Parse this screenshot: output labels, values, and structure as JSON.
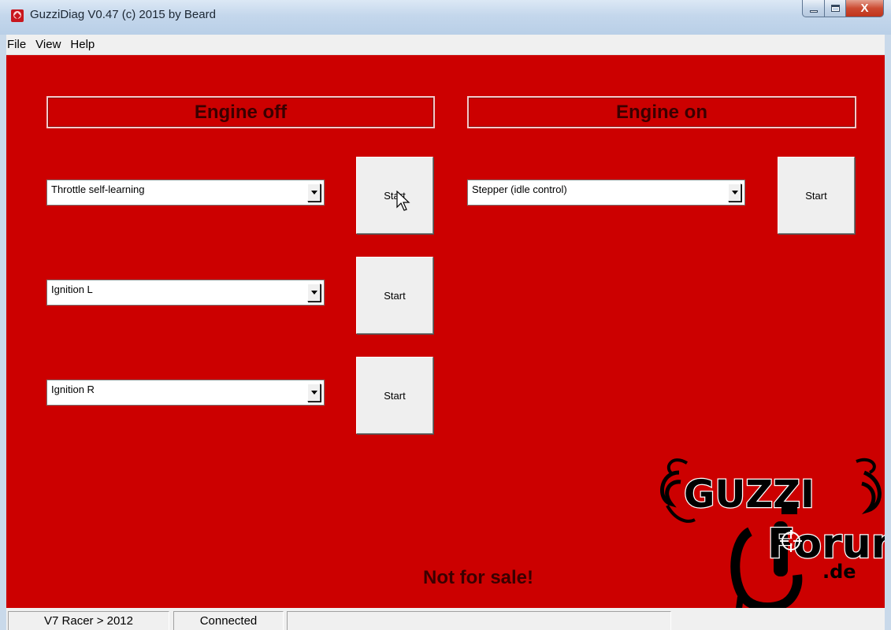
{
  "window": {
    "title": "GuzziDiag V0.47  (c) 2015 by Beard",
    "close_glyph": "X"
  },
  "menu": {
    "items": [
      "File",
      "View",
      "Help"
    ]
  },
  "sections": {
    "engine_off": "Engine off",
    "engine_on": "Engine on"
  },
  "engine_off_tests": [
    {
      "selected": "Throttle self-learning",
      "button": "Start"
    },
    {
      "selected": "Ignition L",
      "button": "Start"
    },
    {
      "selected": "Ignition R",
      "button": "Start"
    }
  ],
  "engine_on_tests": [
    {
      "selected": "Stepper (idle control)",
      "button": "Start"
    }
  ],
  "notice": "Not for sale!",
  "logo": {
    "line1": "GUZZI",
    "line2": "Forum",
    "line3": ".de"
  },
  "statusbar": {
    "model": "V7 Racer > 2012",
    "connection": "Connected",
    "message": ""
  },
  "colors": {
    "background": "#cc0000",
    "header_text": "#3a0000"
  }
}
